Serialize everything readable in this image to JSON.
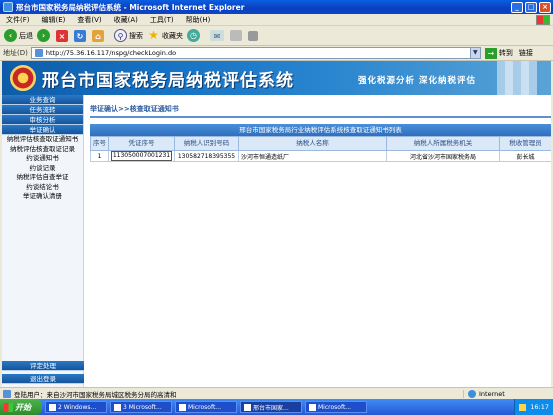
{
  "window": {
    "title": "邢台市国家税务局纳税评估系统 - Microsoft Internet Explorer",
    "controls": [
      "_",
      "□",
      "×"
    ]
  },
  "menu": [
    "文件(F)",
    "编辑(E)",
    "查看(V)",
    "收藏(A)",
    "工具(T)",
    "帮助(H)"
  ],
  "toolbar": {
    "back_label": "后退",
    "search_label": "搜索",
    "favorites_label": "收藏夹"
  },
  "address": {
    "label": "地址(D)",
    "url": "http://75.36.16.117/nspg/checkLogin.do",
    "go_label": "转到",
    "links_label": "链接"
  },
  "banner": {
    "title": "邢台市国家税务局纳税评估系统",
    "slogan": "强化税源分析  深化纳税评估"
  },
  "sidebar": {
    "top_items": [
      "业务查询",
      "任务流转",
      "审核分析",
      "举证确认"
    ],
    "sub_items": [
      "纳税评估核查取证通知书",
      "纳税评估核查取证记录",
      "约谈通知书",
      "约谈记录",
      "纳税评估自查举证",
      "约谈结论书",
      "举证确认清册"
    ],
    "bottom_items": [
      "评定处理",
      "退出登录"
    ]
  },
  "main": {
    "breadcrumb": "举证确认>>核查取证通知书",
    "grid_title": "邢台市国家税务局行业纳税评估系统核查取证通知书列表",
    "columns": [
      "序号",
      "凭证序号",
      "纳税人识别号码",
      "纳税人名称",
      "纳税人所属税务机关",
      "税收管理员"
    ],
    "rows": [
      {
        "index": "1",
        "cert_no": "113050007001231",
        "taxpayer_id": "130582718395355",
        "taxpayer_name": "沙河市恒通造纸厂",
        "tax_office": "河北省沙河市国家税务局",
        "manager": "彭长城"
      }
    ]
  },
  "statusbar": {
    "text": "登陆用户：来自沙河市国家税务局城区税务分局的高清和",
    "zone": "Internet"
  },
  "taskbar": {
    "start_label": "开始",
    "items": [
      "2 Windows...",
      "3 Microsoft...",
      "Microsoft...",
      "邢台市国家...",
      "Microsoft..."
    ],
    "clock": "16:17"
  }
}
